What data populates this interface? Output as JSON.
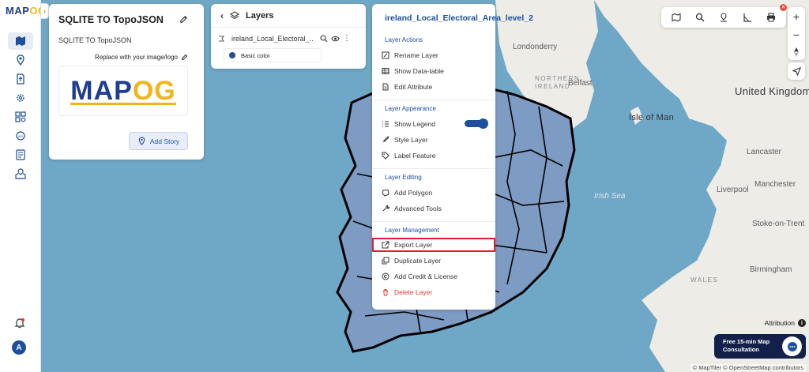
{
  "app": {
    "logo_left": "MAP",
    "logo_right": "OG",
    "collapse_glyph": "›"
  },
  "sidebar": {
    "items": [
      {
        "name": "map-icon",
        "active": true
      },
      {
        "name": "location-pin-icon"
      },
      {
        "name": "upload-file-icon"
      },
      {
        "name": "gear-icon"
      },
      {
        "name": "gallery-icon"
      },
      {
        "name": "api-gear-icon"
      },
      {
        "name": "report-icon"
      },
      {
        "name": "map-pin-share-icon"
      }
    ],
    "avatar_letter": "A"
  },
  "story": {
    "title": "SQLITE TO TopoJSON",
    "description": "SQLITE TO TopoJSON",
    "replace_label": "Replace with your image/logo",
    "logo_text_left": "MAP",
    "logo_text_right": "OG",
    "add_story_label": "Add Story"
  },
  "layers_panel": {
    "title": "Layers",
    "layer_name": "ireland_Local_Electoral_...",
    "style_label": "Basic color",
    "style_color": "#1d4f9c"
  },
  "layer_menu": {
    "layer_title": "ireland_Local_Electoral_Area_level_2",
    "sections": {
      "actions": "Layer Actions",
      "appearance": "Layer Appearance",
      "editing": "Layer Editing",
      "management": "Layer Management"
    },
    "items": {
      "rename": "Rename Layer",
      "datatable": "Show Data-table",
      "edit_attr": "Edit Attribute",
      "legend": "Show Legend",
      "style": "Style Layer",
      "label": "Label Feature",
      "add_polygon": "Add Polygon",
      "advanced": "Advanced Tools",
      "export": "Export Layer",
      "duplicate": "Duplicate Layer",
      "credit": "Add Credit & License",
      "delete": "Delete Layer"
    },
    "show_legend_on": true,
    "highlighted_item": "Export Layer",
    "highlight_color": "#e01e2e"
  },
  "map_labels": {
    "londonderry": "Londonderry",
    "northern_ireland": "NORTHERN\nIRELAND",
    "belfast": "Belfast",
    "isle_of_man": "Isle of Man",
    "united_kingdom": "United Kingdom",
    "lancaster": "Lancaster",
    "irish_sea": "Irish Sea",
    "liverpool": "Liverpool",
    "manchester": "Manchester",
    "stoke": "Stoke-on-Trent",
    "wales": "WALES",
    "birmingham": "Birmingham"
  },
  "attribution": {
    "label": "Attribution",
    "copyright": "© MapTiler © OpenStreetMap contributors"
  },
  "consultation": {
    "line1": "Free 15-min Map",
    "line2": "Consultation"
  },
  "colors": {
    "primary": "#1d4f9c",
    "accent": "#f0b51b",
    "sea": "#6fa7c6",
    "danger": "#e53935"
  }
}
